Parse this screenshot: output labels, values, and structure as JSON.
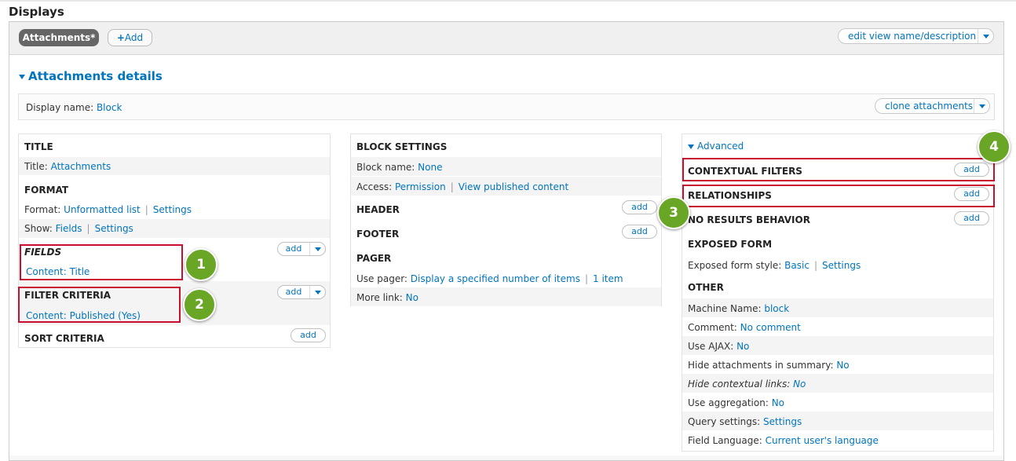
{
  "page": {
    "title": "Displays"
  },
  "tabs": {
    "active_label": "Attachments*",
    "add_label": "Add"
  },
  "edit_view_label": "edit view name/description",
  "details": {
    "title": "Attachments details",
    "display_name_label": "Display name:",
    "display_name_value": "Block",
    "clone_label": "clone attachments"
  },
  "col1": {
    "title_header": "TITLE",
    "title_label": "Title:",
    "title_value": "Attachments",
    "format_header": "FORMAT",
    "format_label": "Format:",
    "format_value": "Unformatted list",
    "format_settings": "Settings",
    "show_label": "Show:",
    "show_value": "Fields",
    "show_settings": "Settings",
    "fields_header": "FIELDS",
    "fields_item": "Content: Title",
    "filter_header": "FILTER CRITERIA",
    "filter_item": "Content: Published (Yes)",
    "sort_header": "SORT CRITERIA",
    "add_label": "add"
  },
  "col2": {
    "block_header": "BLOCK SETTINGS",
    "block_name_label": "Block name:",
    "block_name_value": "None",
    "access_label": "Access:",
    "access_value": "Permission",
    "access_detail": "View published content",
    "header_header": "HEADER",
    "footer_header": "FOOTER",
    "pager_header": "PAGER",
    "use_pager_label": "Use pager:",
    "use_pager_value": "Display a specified number of items",
    "use_pager_count": "1 item",
    "more_link_label": "More link:",
    "more_link_value": "No",
    "add_label": "add"
  },
  "col3": {
    "advanced_label": "Advanced",
    "contextual_header": "CONTEXTUAL FILTERS",
    "relationships_header": "RELATIONSHIPS",
    "no_results_header": "NO RESULTS BEHAVIOR",
    "exposed_header": "EXPOSED FORM",
    "exposed_style_label": "Exposed form style:",
    "exposed_style_value": "Basic",
    "exposed_settings": "Settings",
    "other_header": "OTHER",
    "machine_label": "Machine Name:",
    "machine_value": "block",
    "comment_label": "Comment:",
    "comment_value": "No comment",
    "ajax_label": "Use AJAX:",
    "ajax_value": "No",
    "hide_attach_label": "Hide attachments in summary:",
    "hide_attach_value": "No",
    "hide_ctx_label": "Hide contextual links:",
    "hide_ctx_value": "No",
    "aggregation_label": "Use aggregation:",
    "aggregation_value": "No",
    "query_label": "Query settings:",
    "query_value": "Settings",
    "lang_label": "Field Language:",
    "lang_value": "Current user's language",
    "add_label": "add"
  },
  "markers": [
    "1",
    "2",
    "3",
    "4"
  ],
  "colors": {
    "link": "#0074bd",
    "highlight": "#c8102e",
    "marker": "#6aa626"
  }
}
